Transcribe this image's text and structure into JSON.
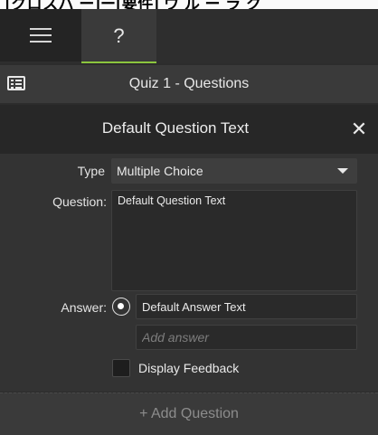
{
  "top_strip": {
    "text": "[クロスバ ー]ー[要件] ウ ル ー ラ ク"
  },
  "tabs": {
    "menu_icon": "hamburger-menu-icon",
    "help_label": "?",
    "active_accent": "#8cc63e"
  },
  "quiz": {
    "icon": "list-icon",
    "title": "Quiz 1 - Questions"
  },
  "question_panel": {
    "title": "Default Question Text",
    "close_glyph": "✕"
  },
  "form": {
    "type_label": "Type",
    "type_value": "Multiple Choice",
    "question_label": "Question:",
    "question_value": "Default Question Text",
    "answer_label": "Answer:",
    "answer_value": "Default Answer Text",
    "add_answer_placeholder": "Add answer",
    "display_feedback_label": "Display Feedback",
    "display_feedback_checked": false
  },
  "footer": {
    "add_question_label": "+ Add Question"
  }
}
